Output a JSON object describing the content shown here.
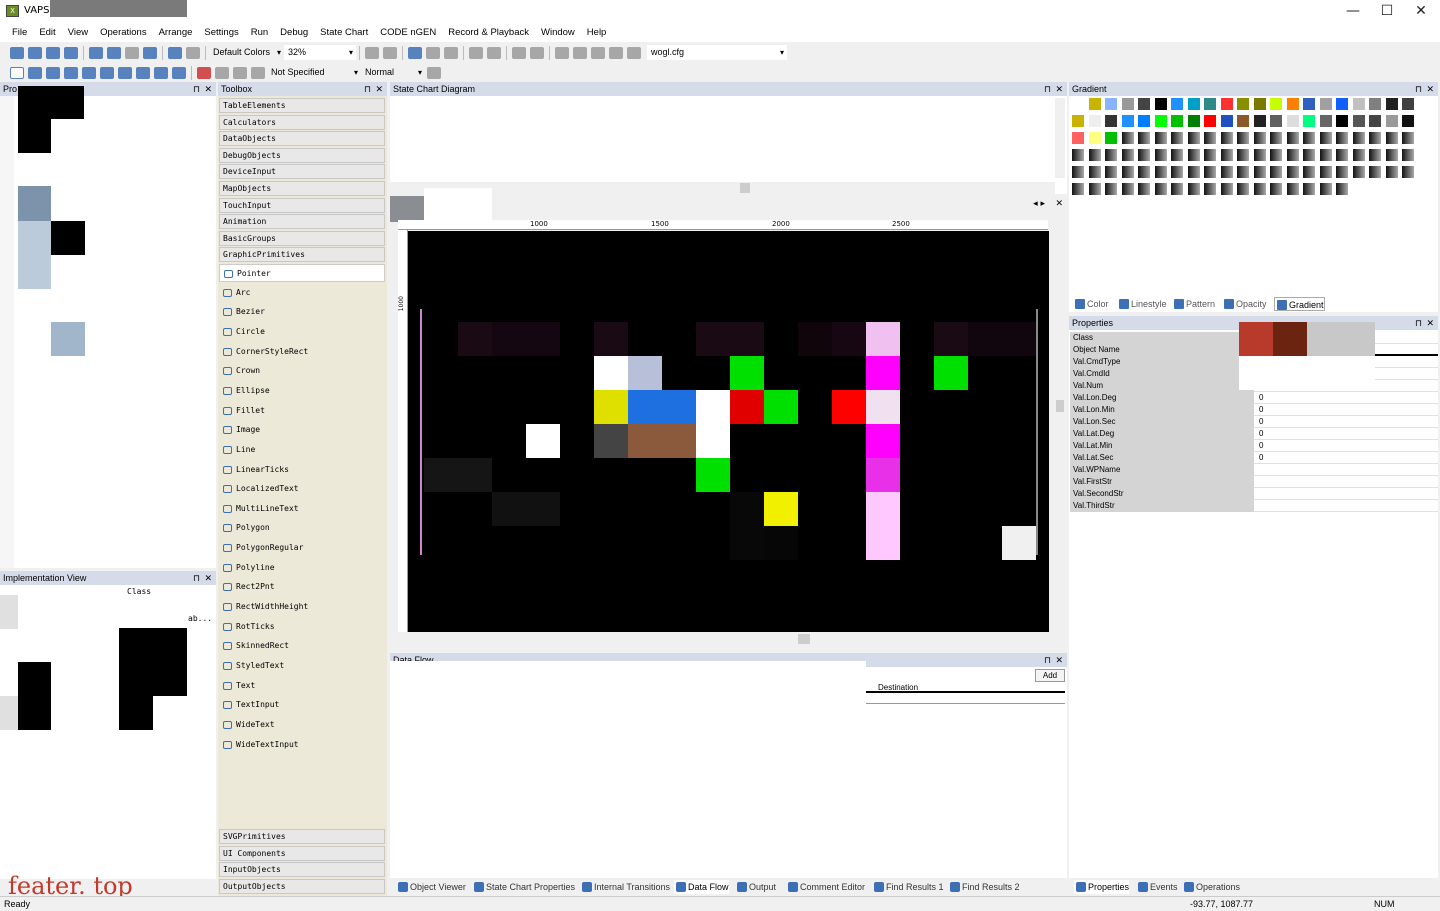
{
  "window": {
    "title": "VAPS X",
    "minimize": "—",
    "maximize": "☐",
    "close": "✕"
  },
  "menu": [
    "File",
    "Edit",
    "View",
    "Operations",
    "Arrange",
    "Settings",
    "Run",
    "Debug",
    "State Chart",
    "CODE nGEN",
    "Record & Playback",
    "Window",
    "Help"
  ],
  "toolbar1": {
    "colors": "Default Colors",
    "zoom": "32%",
    "config": "wogl.cfg"
  },
  "toolbar2": {
    "linestyle": "Not Specified",
    "mode": "Normal"
  },
  "left_panel": {
    "title": "Pro"
  },
  "toolbox": {
    "title": "Toolbox",
    "categories_top": [
      "TableElements",
      "Calculators",
      "DataObjects",
      "DebugObjects",
      "DeviceInput",
      "MapObjects",
      "TouchInput",
      "Animation",
      "BasicGroups",
      "GraphicPrimitives"
    ],
    "tools": [
      "Pointer",
      "Arc",
      "Bezier",
      "Circle",
      "CornerStyleRect",
      "Crown",
      "Ellipse",
      "Fillet",
      "Image",
      "Line",
      "LinearTicks",
      "LocalizedText",
      "MultiLineText",
      "Polygon",
      "PolygonRegular",
      "Polyline",
      "Rect2Pnt",
      "RectWidthHeight",
      "RotTicks",
      "SkinnedRect",
      "StyledText",
      "Text",
      "TextInput",
      "WideText",
      "WideTextInput"
    ],
    "categories_bottom": [
      "SVGPrimitives",
      "UI Components",
      "InputObjects",
      "OutputObjects"
    ]
  },
  "state_chart": {
    "title": "State Chart Diagram"
  },
  "ruler": {
    "labels": [
      "1000",
      "1500",
      "2000",
      "2500"
    ],
    "vlabel": "1000"
  },
  "implementation_view": {
    "title": "Implementation View",
    "class_header": "Class",
    "ab_text": "ab..."
  },
  "data_flow": {
    "title": "Data Flow",
    "add_button": "Add",
    "destination": "Destination"
  },
  "gradient": {
    "title": "Gradient",
    "tabs": [
      "Color",
      "Linestyle",
      "Pattern",
      "Opacity",
      "Gradient"
    ]
  },
  "properties": {
    "title": "Properties",
    "rows": [
      {
        "k": "Class",
        "v": ""
      },
      {
        "k": "Object Name",
        "v": ""
      },
      {
        "k": "Val.CmdType",
        "v": ""
      },
      {
        "k": "Val.CmdId",
        "v": ""
      },
      {
        "k": "Val.Num",
        "v": ""
      },
      {
        "k": "Val.Lon.Deg",
        "v": "0"
      },
      {
        "k": "Val.Lon.Min",
        "v": "0"
      },
      {
        "k": "Val.Lon.Sec",
        "v": "0"
      },
      {
        "k": "Val.Lat.Deg",
        "v": "0"
      },
      {
        "k": "Val.Lat.Min",
        "v": "0"
      },
      {
        "k": "Val.Lat.Sec",
        "v": "0"
      },
      {
        "k": "Val.WPName",
        "v": ""
      },
      {
        "k": "Val.FirstStr",
        "v": ""
      },
      {
        "k": "Val.SecondStr",
        "v": ""
      },
      {
        "k": "Val.ThirdStr",
        "v": ""
      }
    ]
  },
  "bottom_tabs_center": [
    "Object Viewer",
    "State Chart Properties",
    "Internal Transitions",
    "Data Flow",
    "Output",
    "Comment Editor",
    "Find Results 1",
    "Find Results 2"
  ],
  "bottom_tabs_right": [
    "Properties",
    "Events",
    "Operations"
  ],
  "watermark": "feater. top",
  "status": {
    "left": "Ready",
    "coords": "-93.77, 1087.77",
    "num": "NUM"
  }
}
